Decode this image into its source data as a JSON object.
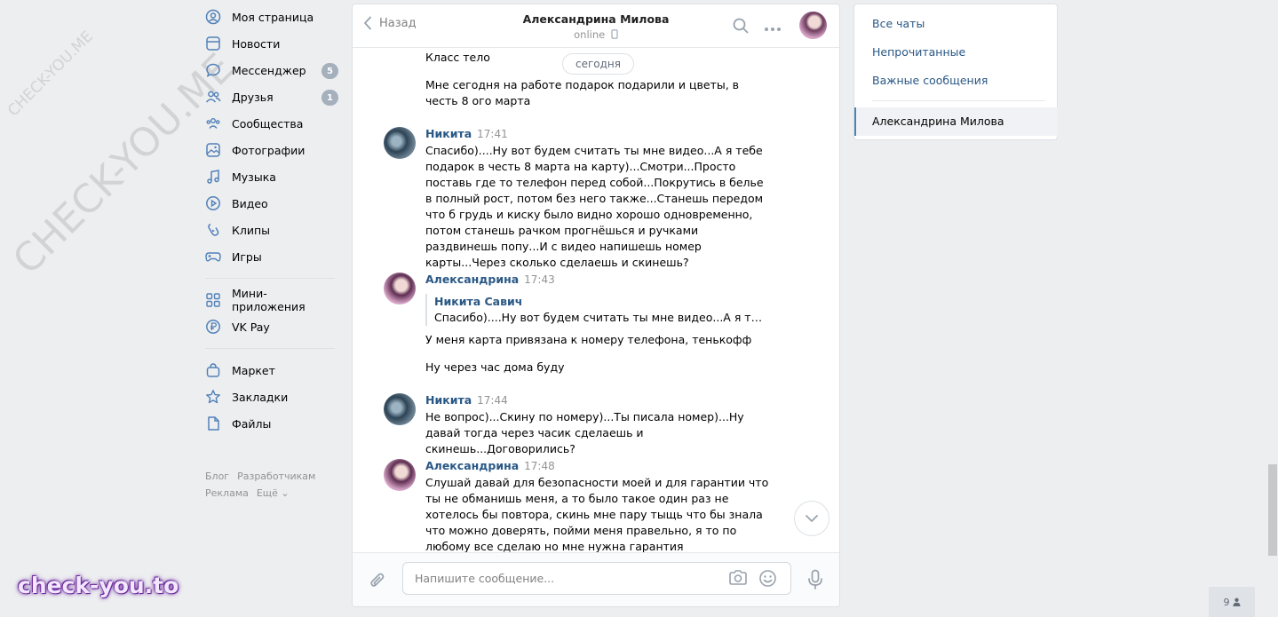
{
  "nav": {
    "items": [
      {
        "label": "Моя страница",
        "icon": "user-circle-icon"
      },
      {
        "label": "Новости",
        "icon": "news-icon"
      },
      {
        "label": "Мессенджер",
        "icon": "message-icon",
        "badge": "5"
      },
      {
        "label": "Друзья",
        "icon": "friends-icon",
        "badge": "1"
      },
      {
        "label": "Сообщества",
        "icon": "communities-icon"
      },
      {
        "label": "Фотографии",
        "icon": "photo-icon"
      },
      {
        "label": "Музыка",
        "icon": "music-icon"
      },
      {
        "label": "Видео",
        "icon": "video-icon"
      },
      {
        "label": "Клипы",
        "icon": "clips-icon"
      },
      {
        "label": "Игры",
        "icon": "gamepad-icon"
      }
    ],
    "items2": [
      {
        "label": "Мини-приложения",
        "icon": "apps-icon"
      },
      {
        "label": "VK Pay",
        "icon": "vkpay-icon"
      }
    ],
    "items3": [
      {
        "label": "Маркет",
        "icon": "bag-icon"
      },
      {
        "label": "Закладки",
        "icon": "star-icon"
      },
      {
        "label": "Файлы",
        "icon": "file-icon"
      }
    ],
    "footer": {
      "blog": "Блог",
      "dev": "Разработчикам",
      "ads": "Реклама",
      "more": "Ещё ⌄"
    }
  },
  "chat": {
    "back_label": "Назад",
    "title": "Александрина Милова",
    "status": "online",
    "date_pill": "сегодня",
    "messages": [
      {
        "text": "Класс тело"
      },
      {
        "text": "Мне сегодня на работе подарок подарили и цветы, в честь 8 ого марта"
      },
      {
        "author": "Никита",
        "time": "17:41",
        "text": "Спасибо)....Ну вот будем считать ты мне видео...А я тебе подарок в честь 8 марта на карту)...Смотри...Просто поставь где то телефон перед собой...Покрутись в белье в полный рост, потом без него также...Станешь передом что б грудь и киску было видно хорошо одновременно, потом станешь рачком прогнёшься и ручками раздвинешь попу...И с видео напишешь номер карты...Через сколько сделаешь и скинешь?"
      },
      {
        "author": "Александрина",
        "time": "17:43",
        "quote_author": "Никита Савич",
        "quote_text": "Спасибо)....Ну вот будем считать ты мне видео...А я тебе по…",
        "text": "У меня карта привязана к номеру телефона, тенькофф",
        "text2": "Ну через час дома буду"
      },
      {
        "author": "Никита",
        "time": "17:44",
        "text": "Не вопрос)...Скину по номеру)...Ты писала номер)...Ну давай тогда через часик сделаешь и скинешь...Договорились?"
      },
      {
        "author": "Александрина",
        "time": "17:48",
        "text": "Слушай давай для безопасности моей и для гарантии что ты не обманишь меня, а то было такое один раз не хотелось бы повтора, скинь мне пару тыщь что бы знала что можно доверять, пойми меня правельно, я то по любому все сделаю но мне нужна гарантия"
      }
    ],
    "composer_placeholder": "Напишите сообщение..."
  },
  "right": {
    "all_chats": "Все чаты",
    "unread": "Непрочитанные",
    "important": "Важные сообщения",
    "active_chat": "Александрина Милова"
  },
  "watermark": {
    "small": "CHECK-YOU.ME",
    "large": "CHECK-YOU.ME",
    "brand": "check-you.to"
  },
  "online_count": "9"
}
